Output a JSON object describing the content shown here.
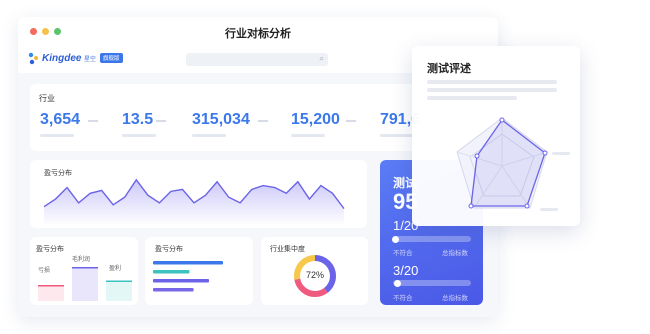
{
  "window": {
    "title": "行业对标分析"
  },
  "app": {
    "logo": "Kingdee",
    "product": "星空",
    "edition": "旗舰版"
  },
  "stats": {
    "label": "行业",
    "items": [
      {
        "value": "3,654"
      },
      {
        "value": "13.5"
      },
      {
        "value": "315,034"
      },
      {
        "value": "15,200"
      },
      {
        "value": "791,6"
      }
    ]
  },
  "trend": {
    "title": "盈亏分布"
  },
  "profit_card": {
    "title": "盈亏分布",
    "bar1": "亏损",
    "bar2": "毛利润",
    "bar3": "盈利"
  },
  "distribution_card": {
    "title": "盈亏分布"
  },
  "concentration_card": {
    "title": "行业集中度",
    "value": "72%",
    "percent": 72
  },
  "score_card": {
    "title": "测试",
    "score": "95",
    "row1": {
      "value": "1/20",
      "left": "不符合",
      "right": "总指标数",
      "progress": 0.05
    },
    "row2": {
      "value": "3/20",
      "left": "不符合",
      "right": "总指标数",
      "progress": 0.15
    }
  },
  "review": {
    "title": "测试评述"
  },
  "colors": {
    "accent": "#3b78ea",
    "purple": "#6b63e8",
    "teal": "#3cc3c0",
    "pink": "#f05a7e",
    "yellow": "#f7c84a"
  },
  "chart_data": [
    {
      "type": "area",
      "title": "盈亏分布",
      "values": [
        18,
        26,
        38,
        22,
        32,
        35,
        20,
        28,
        46,
        30,
        22,
        34,
        36,
        22,
        30,
        44,
        28,
        22,
        36,
        40,
        38,
        32,
        44,
        26,
        40,
        32,
        16
      ]
    },
    {
      "type": "bar",
      "title": "盈亏分布",
      "categories": [
        "亏损",
        "毛利润",
        "盈利"
      ],
      "values": [
        40,
        100,
        55
      ]
    },
    {
      "type": "bar",
      "title": "盈亏分布",
      "values": [
        100,
        52,
        80,
        58
      ]
    },
    {
      "type": "pie",
      "title": "行业集中度",
      "values": [
        72
      ]
    }
  ]
}
